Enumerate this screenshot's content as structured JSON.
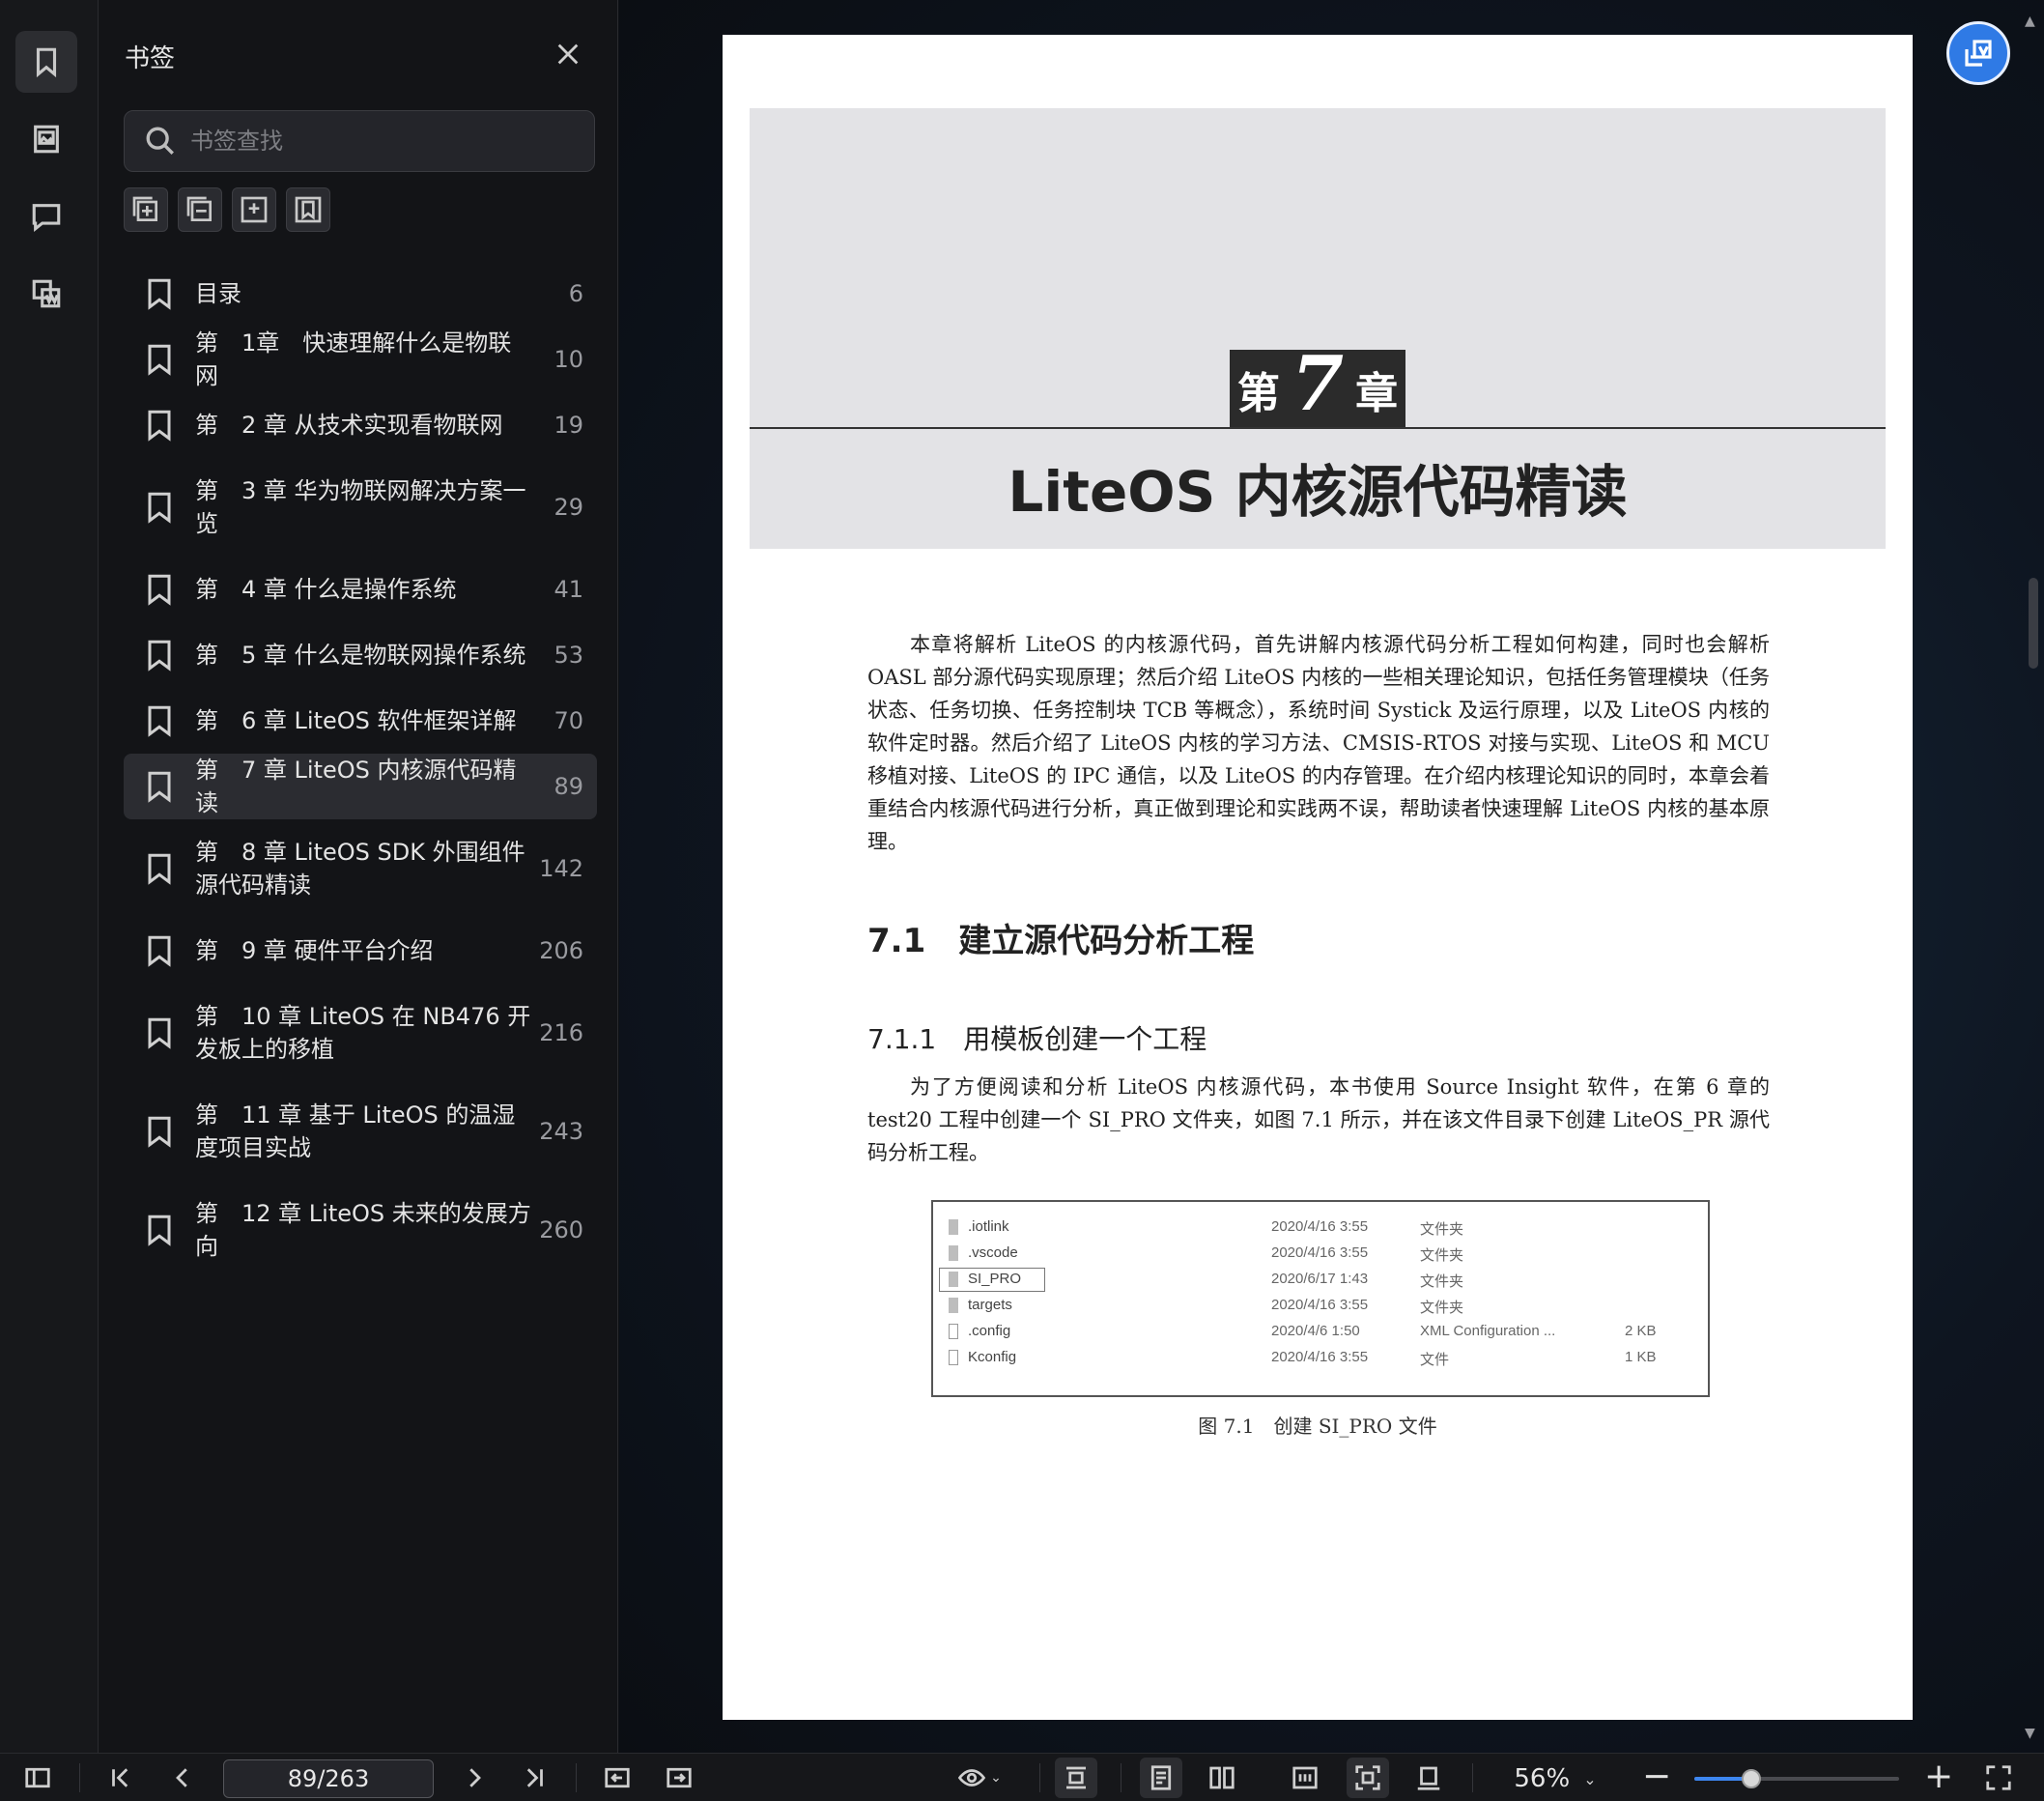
{
  "panel": {
    "title": "书签",
    "search_placeholder": "书签查找",
    "bookmarks": [
      {
        "label": "目录",
        "page": "6"
      },
      {
        "label": "第　1章　快速理解什么是物联网",
        "page": "10"
      },
      {
        "label": "第　2 章 从技术实现看物联网",
        "page": "19"
      },
      {
        "label": "第　3 章 华为物联网解决方案一览",
        "page": "29"
      },
      {
        "label": "第　4 章 什么是操作系统",
        "page": "41"
      },
      {
        "label": "第　5 章 什么是物联网操作系统",
        "page": "53"
      },
      {
        "label": "第　6 章 LiteOS 软件框架详解",
        "page": "70"
      },
      {
        "label": "第　7 章 LiteOS 内核源代码精读",
        "page": "89"
      },
      {
        "label": "第　8 章 LiteOS SDK 外围组件源代码精读",
        "page": "142"
      },
      {
        "label": "第　9 章 硬件平台介绍",
        "page": "206"
      },
      {
        "label": "第　10 章 LiteOS 在 NB476 开发板上的移植",
        "page": "216"
      },
      {
        "label": "第　11 章 基于 LiteOS 的温湿度项目实战",
        "page": "243"
      },
      {
        "label": "第　12 章 LiteOS 未来的发展方向",
        "page": "260"
      }
    ]
  },
  "document": {
    "chapter_prefix": "第",
    "chapter_number": "7",
    "chapter_suffix": "章",
    "chapter_title": "LiteOS 内核源代码精读",
    "intro": "本章将解析 LiteOS 的内核源代码，首先讲解内核源代码分析工程如何构建，同时也会解析 OASL 部分源代码实现原理；然后介绍 LiteOS 内核的一些相关理论知识，包括任务管理模块（任务状态、任务切换、任务控制块 TCB 等概念），系统时间 Systick 及运行原理，以及 LiteOS 内核的软件定时器。然后介绍了 LiteOS 内核的学习方法、CMSIS-RTOS 对接与实现、LiteOS 和 MCU 移植对接、LiteOS 的 IPC 通信，以及 LiteOS 的内存管理。在介绍内核理论知识的同时，本章会着重结合内核源代码进行分析，真正做到理论和实践两不误，帮助读者快速理解 LiteOS 内核的基本原理。",
    "section_71": "7.1　建立源代码分析工程",
    "section_711": "7.1.1　用模板创建一个工程",
    "body_711": "为了方便阅读和分析 LiteOS 内核源代码，本书使用 Source Insight 软件，在第 6 章的 test20 工程中创建一个 SI_PRO 文件夹，如图 7.1 所示，并在该文件目录下创建 LiteOS_PR 源代码分析工程。",
    "figure_rows": [
      {
        "name": ".iotlink",
        "date": "2020/4/16 3:55",
        "type": "文件夹",
        "size": "",
        "kind": "folder"
      },
      {
        "name": ".vscode",
        "date": "2020/4/16 3:55",
        "type": "文件夹",
        "size": "",
        "kind": "folder"
      },
      {
        "name": "SI_PRO",
        "date": "2020/6/17 1:43",
        "type": "文件夹",
        "size": "",
        "kind": "folder"
      },
      {
        "name": "targets",
        "date": "2020/4/16 3:55",
        "type": "文件夹",
        "size": "",
        "kind": "folder"
      },
      {
        "name": ".config",
        "date": "2020/4/6 1:50",
        "type": "XML Configuration ...",
        "size": "2 KB",
        "kind": "file"
      },
      {
        "name": "Kconfig",
        "date": "2020/4/16 3:55",
        "type": "文件",
        "size": "1 KB",
        "kind": "file"
      }
    ],
    "figure_caption": "图 7.1　创建 SI_PRO 文件"
  },
  "toolbar": {
    "page_indicator": "89/263",
    "zoom": "56%",
    "zoom_fraction": 0.28
  },
  "colors": {
    "accent": "#2f7ae5",
    "panel_bg": "#131417",
    "active_row": "#2b2c31"
  }
}
